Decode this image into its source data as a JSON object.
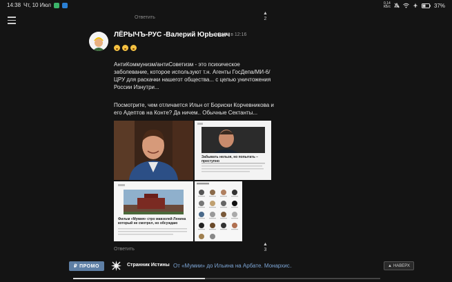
{
  "status": {
    "time": "14:38",
    "date": "Чт, 10 Июл",
    "speed": "0,14",
    "speed_unit": "КБ/с",
    "battery": "37"
  },
  "top_comment": {
    "reply_label": "Ответить",
    "score": "2"
  },
  "comment": {
    "author": "ЛЁРЫЧЪ-РУС -Валерий ЮрЬевич",
    "time": "сегодня в 12:16",
    "paragraph1": "АнтиКоммунизм/антиСоветизм - это психическое заболевание, которое используют т.н. Агенты ГосДепа/МИ-6/ЦРУ для раскачки нашегот общества... с целью уничтожения России Изнутри...",
    "paragraph2": "Посмотрите, чем отличается Ильн от Бориски Корчевникова и его Адептов на Конте? Да ничем.. Обычные Сектанты...",
    "reply_label": "Ответить",
    "score": "3"
  },
  "collage": {
    "tr_title": "Забывать нельзя, но попытать – преступно",
    "bl_title": "Фильм «Мумия» стро мавзолей Ленина который не смотрел, но обсуждаю"
  },
  "bottom": {
    "promo_label": "ПРОМО",
    "channel": "Странник Истины",
    "article": "От «Мумии» до Ильина на Арбате. Монархис...",
    "up_label": "НАВЕРХ",
    "progress": 0.43
  },
  "colors": {
    "accent": "#5e7fa5",
    "link": "#7da6d6",
    "bg": "#141414"
  }
}
